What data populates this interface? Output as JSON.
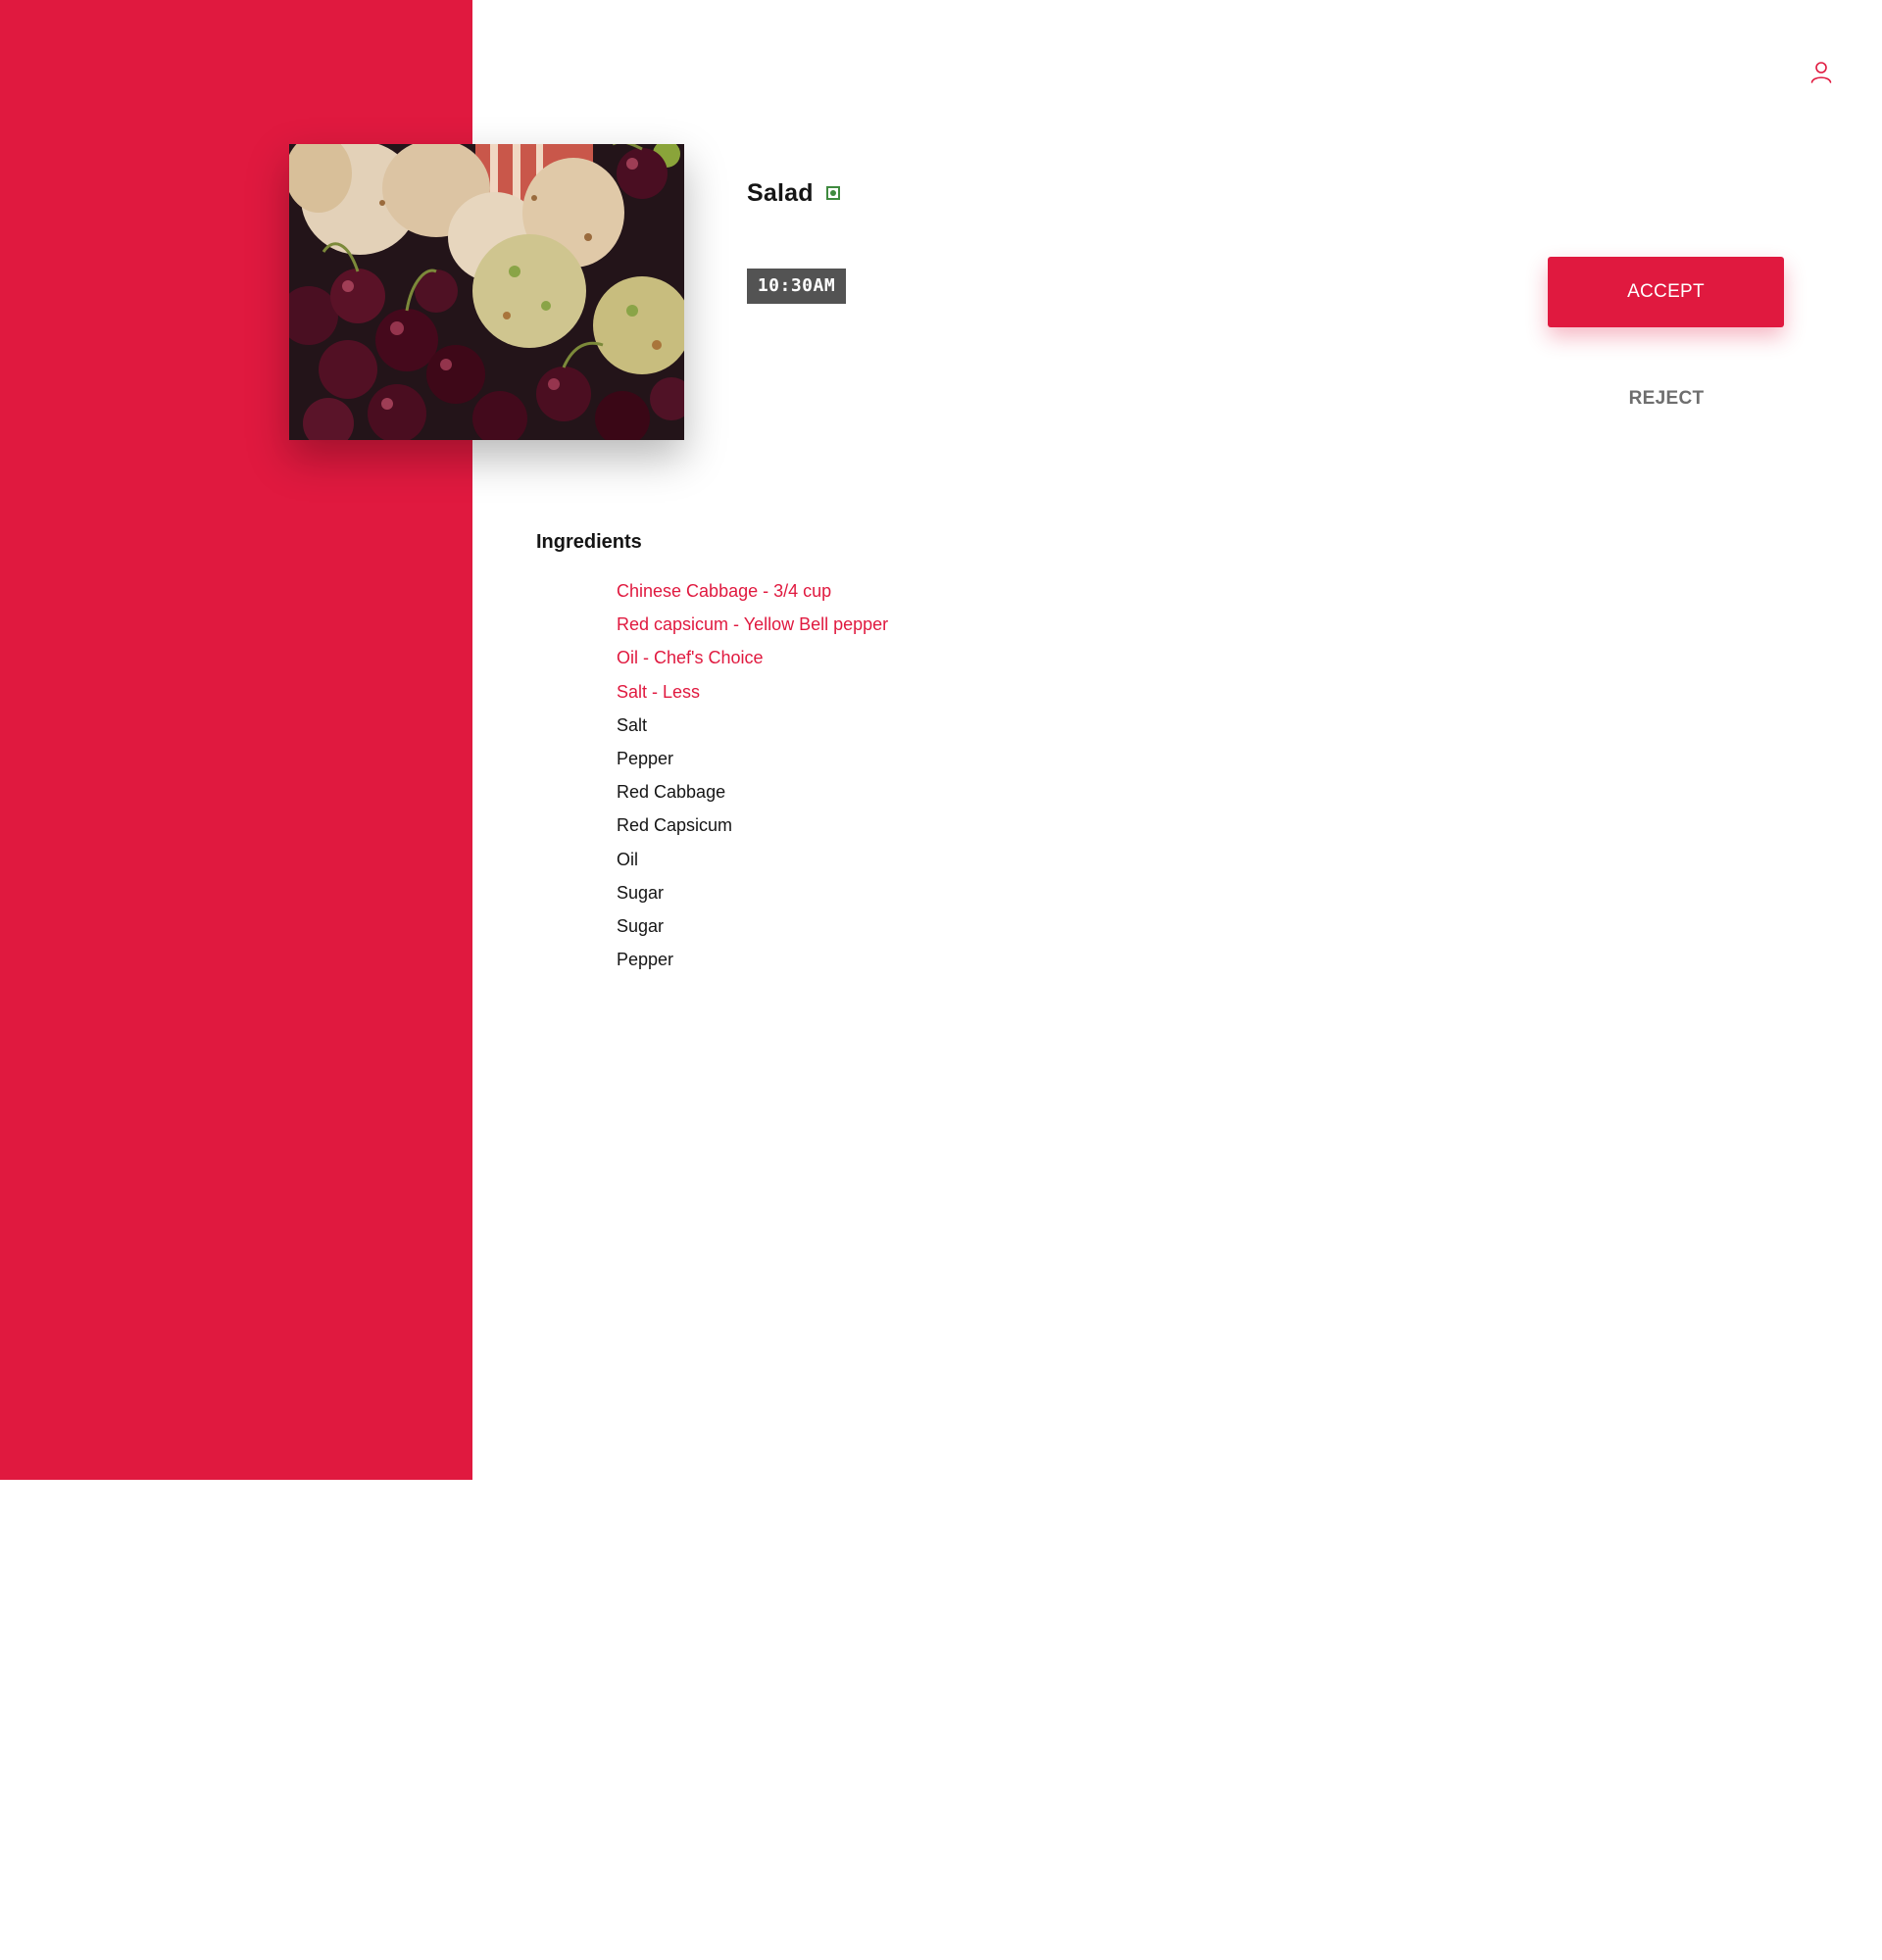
{
  "colors": {
    "accent": "#e0193f",
    "veg": "#3f8a3f",
    "time_badge": "#535353",
    "reject_text": "#6e6e6e"
  },
  "header": {
    "profile_icon": "user-profile-icon"
  },
  "dish": {
    "photo_icon": "food-photo",
    "title": "Salad",
    "diet_icon": "veg-indicator-icon",
    "time": "10:30AM"
  },
  "actions": {
    "accept_label": "ACCEPT",
    "reject_label": "REJECT"
  },
  "ingredients": {
    "heading": "Ingredients",
    "items": [
      {
        "text": "Chinese Cabbage - 3/4 cup",
        "modified": true
      },
      {
        "text": "Red capsicum - Yellow Bell pepper",
        "modified": true
      },
      {
        "text": "Oil - Chef's Choice",
        "modified": true
      },
      {
        "text": "Salt - Less",
        "modified": true
      },
      {
        "text": "Salt",
        "modified": false
      },
      {
        "text": "Pepper",
        "modified": false
      },
      {
        "text": "Red Cabbage",
        "modified": false
      },
      {
        "text": "Red Capsicum",
        "modified": false
      },
      {
        "text": "Oil",
        "modified": false
      },
      {
        "text": "Sugar",
        "modified": false
      },
      {
        "text": "Sugar",
        "modified": false
      },
      {
        "text": "Pepper",
        "modified": false
      }
    ]
  }
}
